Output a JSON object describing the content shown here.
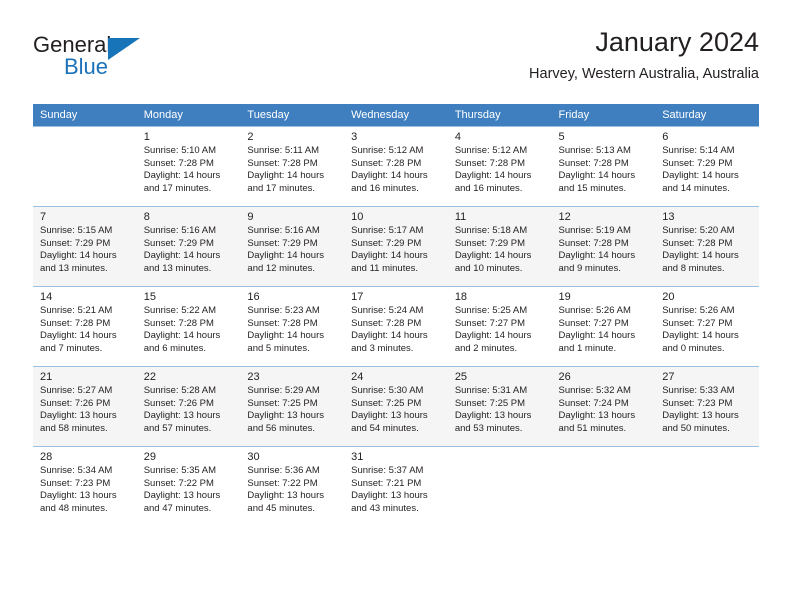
{
  "brand": {
    "name_part1": "General",
    "name_part2": "Blue",
    "triangle_color": "#1874b9",
    "text_color": "#231f20"
  },
  "header": {
    "title": "January 2024",
    "subtitle": "Harvey, Western Australia, Australia"
  },
  "theme": {
    "header_row_bg": "#3f7fbf",
    "header_row_text": "#ffffff",
    "alt_row_bg": "#f5f5f5",
    "cell_border": "#9dbfdf"
  },
  "weekdays": [
    "Sunday",
    "Monday",
    "Tuesday",
    "Wednesday",
    "Thursday",
    "Friday",
    "Saturday"
  ],
  "weeks": [
    [
      {
        "day": "",
        "sunrise": "",
        "sunset": "",
        "daylight1": "",
        "daylight2": ""
      },
      {
        "day": "1",
        "sunrise": "Sunrise: 5:10 AM",
        "sunset": "Sunset: 7:28 PM",
        "daylight1": "Daylight: 14 hours",
        "daylight2": "and 17 minutes."
      },
      {
        "day": "2",
        "sunrise": "Sunrise: 5:11 AM",
        "sunset": "Sunset: 7:28 PM",
        "daylight1": "Daylight: 14 hours",
        "daylight2": "and 17 minutes."
      },
      {
        "day": "3",
        "sunrise": "Sunrise: 5:12 AM",
        "sunset": "Sunset: 7:28 PM",
        "daylight1": "Daylight: 14 hours",
        "daylight2": "and 16 minutes."
      },
      {
        "day": "4",
        "sunrise": "Sunrise: 5:12 AM",
        "sunset": "Sunset: 7:28 PM",
        "daylight1": "Daylight: 14 hours",
        "daylight2": "and 16 minutes."
      },
      {
        "day": "5",
        "sunrise": "Sunrise: 5:13 AM",
        "sunset": "Sunset: 7:28 PM",
        "daylight1": "Daylight: 14 hours",
        "daylight2": "and 15 minutes."
      },
      {
        "day": "6",
        "sunrise": "Sunrise: 5:14 AM",
        "sunset": "Sunset: 7:29 PM",
        "daylight1": "Daylight: 14 hours",
        "daylight2": "and 14 minutes."
      }
    ],
    [
      {
        "day": "7",
        "sunrise": "Sunrise: 5:15 AM",
        "sunset": "Sunset: 7:29 PM",
        "daylight1": "Daylight: 14 hours",
        "daylight2": "and 13 minutes."
      },
      {
        "day": "8",
        "sunrise": "Sunrise: 5:16 AM",
        "sunset": "Sunset: 7:29 PM",
        "daylight1": "Daylight: 14 hours",
        "daylight2": "and 13 minutes."
      },
      {
        "day": "9",
        "sunrise": "Sunrise: 5:16 AM",
        "sunset": "Sunset: 7:29 PM",
        "daylight1": "Daylight: 14 hours",
        "daylight2": "and 12 minutes."
      },
      {
        "day": "10",
        "sunrise": "Sunrise: 5:17 AM",
        "sunset": "Sunset: 7:29 PM",
        "daylight1": "Daylight: 14 hours",
        "daylight2": "and 11 minutes."
      },
      {
        "day": "11",
        "sunrise": "Sunrise: 5:18 AM",
        "sunset": "Sunset: 7:29 PM",
        "daylight1": "Daylight: 14 hours",
        "daylight2": "and 10 minutes."
      },
      {
        "day": "12",
        "sunrise": "Sunrise: 5:19 AM",
        "sunset": "Sunset: 7:28 PM",
        "daylight1": "Daylight: 14 hours",
        "daylight2": "and 9 minutes."
      },
      {
        "day": "13",
        "sunrise": "Sunrise: 5:20 AM",
        "sunset": "Sunset: 7:28 PM",
        "daylight1": "Daylight: 14 hours",
        "daylight2": "and 8 minutes."
      }
    ],
    [
      {
        "day": "14",
        "sunrise": "Sunrise: 5:21 AM",
        "sunset": "Sunset: 7:28 PM",
        "daylight1": "Daylight: 14 hours",
        "daylight2": "and 7 minutes."
      },
      {
        "day": "15",
        "sunrise": "Sunrise: 5:22 AM",
        "sunset": "Sunset: 7:28 PM",
        "daylight1": "Daylight: 14 hours",
        "daylight2": "and 6 minutes."
      },
      {
        "day": "16",
        "sunrise": "Sunrise: 5:23 AM",
        "sunset": "Sunset: 7:28 PM",
        "daylight1": "Daylight: 14 hours",
        "daylight2": "and 5 minutes."
      },
      {
        "day": "17",
        "sunrise": "Sunrise: 5:24 AM",
        "sunset": "Sunset: 7:28 PM",
        "daylight1": "Daylight: 14 hours",
        "daylight2": "and 3 minutes."
      },
      {
        "day": "18",
        "sunrise": "Sunrise: 5:25 AM",
        "sunset": "Sunset: 7:27 PM",
        "daylight1": "Daylight: 14 hours",
        "daylight2": "and 2 minutes."
      },
      {
        "day": "19",
        "sunrise": "Sunrise: 5:26 AM",
        "sunset": "Sunset: 7:27 PM",
        "daylight1": "Daylight: 14 hours",
        "daylight2": "and 1 minute."
      },
      {
        "day": "20",
        "sunrise": "Sunrise: 5:26 AM",
        "sunset": "Sunset: 7:27 PM",
        "daylight1": "Daylight: 14 hours",
        "daylight2": "and 0 minutes."
      }
    ],
    [
      {
        "day": "21",
        "sunrise": "Sunrise: 5:27 AM",
        "sunset": "Sunset: 7:26 PM",
        "daylight1": "Daylight: 13 hours",
        "daylight2": "and 58 minutes."
      },
      {
        "day": "22",
        "sunrise": "Sunrise: 5:28 AM",
        "sunset": "Sunset: 7:26 PM",
        "daylight1": "Daylight: 13 hours",
        "daylight2": "and 57 minutes."
      },
      {
        "day": "23",
        "sunrise": "Sunrise: 5:29 AM",
        "sunset": "Sunset: 7:25 PM",
        "daylight1": "Daylight: 13 hours",
        "daylight2": "and 56 minutes."
      },
      {
        "day": "24",
        "sunrise": "Sunrise: 5:30 AM",
        "sunset": "Sunset: 7:25 PM",
        "daylight1": "Daylight: 13 hours",
        "daylight2": "and 54 minutes."
      },
      {
        "day": "25",
        "sunrise": "Sunrise: 5:31 AM",
        "sunset": "Sunset: 7:25 PM",
        "daylight1": "Daylight: 13 hours",
        "daylight2": "and 53 minutes."
      },
      {
        "day": "26",
        "sunrise": "Sunrise: 5:32 AM",
        "sunset": "Sunset: 7:24 PM",
        "daylight1": "Daylight: 13 hours",
        "daylight2": "and 51 minutes."
      },
      {
        "day": "27",
        "sunrise": "Sunrise: 5:33 AM",
        "sunset": "Sunset: 7:23 PM",
        "daylight1": "Daylight: 13 hours",
        "daylight2": "and 50 minutes."
      }
    ],
    [
      {
        "day": "28",
        "sunrise": "Sunrise: 5:34 AM",
        "sunset": "Sunset: 7:23 PM",
        "daylight1": "Daylight: 13 hours",
        "daylight2": "and 48 minutes."
      },
      {
        "day": "29",
        "sunrise": "Sunrise: 5:35 AM",
        "sunset": "Sunset: 7:22 PM",
        "daylight1": "Daylight: 13 hours",
        "daylight2": "and 47 minutes."
      },
      {
        "day": "30",
        "sunrise": "Sunrise: 5:36 AM",
        "sunset": "Sunset: 7:22 PM",
        "daylight1": "Daylight: 13 hours",
        "daylight2": "and 45 minutes."
      },
      {
        "day": "31",
        "sunrise": "Sunrise: 5:37 AM",
        "sunset": "Sunset: 7:21 PM",
        "daylight1": "Daylight: 13 hours",
        "daylight2": "and 43 minutes."
      },
      {
        "day": "",
        "sunrise": "",
        "sunset": "",
        "daylight1": "",
        "daylight2": ""
      },
      {
        "day": "",
        "sunrise": "",
        "sunset": "",
        "daylight1": "",
        "daylight2": ""
      },
      {
        "day": "",
        "sunrise": "",
        "sunset": "",
        "daylight1": "",
        "daylight2": ""
      }
    ]
  ]
}
